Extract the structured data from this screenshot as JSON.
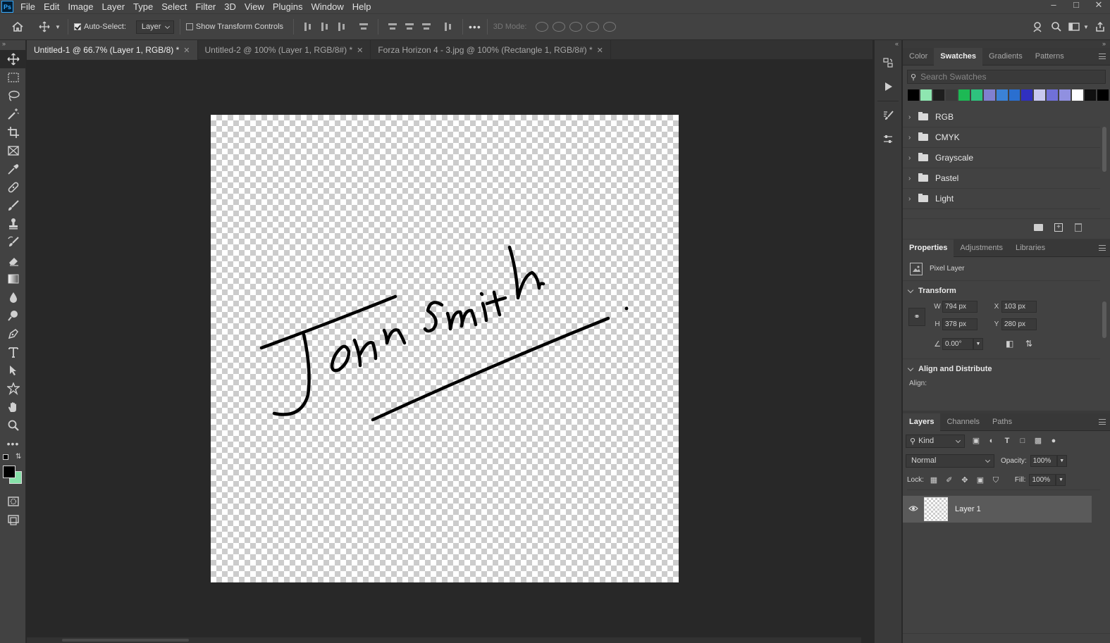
{
  "app": {
    "logo": "Ps"
  },
  "menu": [
    "File",
    "Edit",
    "Image",
    "Layer",
    "Type",
    "Select",
    "Filter",
    "3D",
    "View",
    "Plugins",
    "Window",
    "Help"
  ],
  "options": {
    "auto_select_label": "Auto-Select:",
    "auto_select_checked": true,
    "target": "Layer",
    "show_transform_label": "Show Transform Controls",
    "more": "•••",
    "mode_3d_label": "3D Mode:"
  },
  "doc_tabs": [
    {
      "label": "Untitled-1 @ 66.7% (Layer 1, RGB/8) *",
      "active": true
    },
    {
      "label": "Untitled-2 @ 100% (Layer 1, RGB/8#) *",
      "active": false
    },
    {
      "label": "Forza Horizon 4 - 3.jpg @ 100% (Rectangle 1, RGB/8#) *",
      "active": false
    }
  ],
  "colors": {
    "foreground": "#000000",
    "background": "#86e0a8",
    "accent": "#31a8ff"
  },
  "swatches_panel": {
    "tabs": [
      "Color",
      "Swatches",
      "Gradients",
      "Patterns"
    ],
    "active_tab": "Swatches",
    "search_placeholder": "Search Swatches",
    "swatch_colors": [
      "#000000",
      "#8ee6b0",
      "#1e1e1e",
      "#3a3a3a",
      "#1db954",
      "#2ec27e",
      "#8080d0",
      "#3b82d6",
      "#2a6fd0",
      "#3030c0",
      "#c8c8f0",
      "#7070d8",
      "#9090e0",
      "#ffffff",
      "#101010",
      "#000000"
    ],
    "folders": [
      "RGB",
      "CMYK",
      "Grayscale",
      "Pastel",
      "Light"
    ]
  },
  "properties_panel": {
    "tabs": [
      "Properties",
      "Adjustments",
      "Libraries"
    ],
    "active_tab": "Properties",
    "layer_type": "Pixel Layer",
    "transform_title": "Transform",
    "w_label": "W",
    "w": "794 px",
    "h_label": "H",
    "h": "378 px",
    "x_label": "X",
    "x": "103 px",
    "y_label": "Y",
    "y": "280 px",
    "angle": "0.00°",
    "align_title": "Align and Distribute",
    "align_label": "Align:"
  },
  "layers_panel": {
    "tabs": [
      "Layers",
      "Channels",
      "Paths"
    ],
    "active_tab": "Layers",
    "filter_kind": "Kind",
    "blend_mode": "Normal",
    "opacity_label": "Opacity:",
    "opacity": "100%",
    "lock_label": "Lock:",
    "fill_label": "Fill:",
    "fill": "100%",
    "layers": [
      {
        "name": "Layer 1",
        "visible": true
      }
    ]
  },
  "icons": {
    "home": "home-icon",
    "move": "move-icon",
    "search": "search-icon"
  }
}
